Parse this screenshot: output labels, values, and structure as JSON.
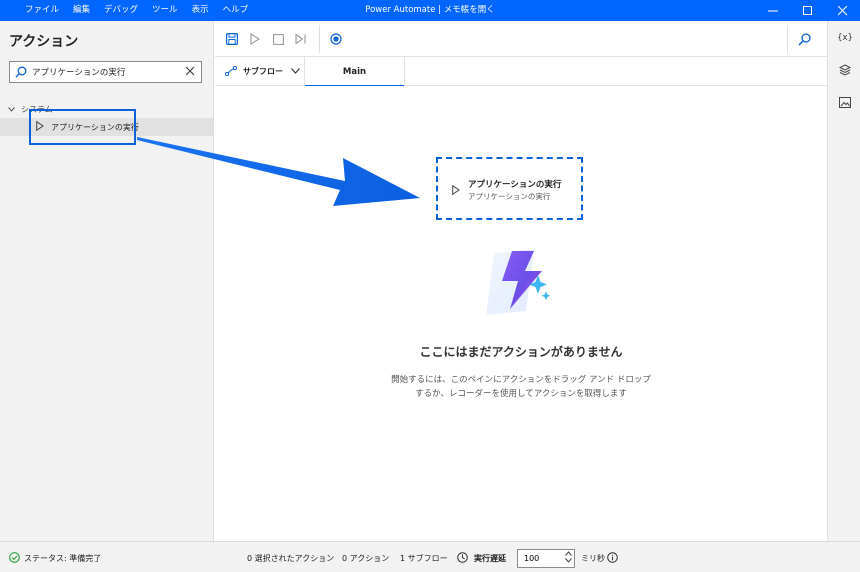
{
  "titlebar": {
    "menu": [
      "ファイル",
      "編集",
      "デバッグ",
      "ツール",
      "表示",
      "ヘルプ"
    ],
    "title": "Power Automate | メモ帳を開く"
  },
  "actions_panel": {
    "title": "アクション",
    "search": {
      "value": "アプリケーションの実行",
      "placeholder": "アクションの検索"
    },
    "category": "システム",
    "item": "アプリケーションの実行"
  },
  "tabs": {
    "subflow_label": "サブフロー",
    "main_tab": "Main"
  },
  "drag_card": {
    "title": "アプリケーションの実行",
    "subtitle": "アプリケーションの実行"
  },
  "empty_state": {
    "title": "ここにはまだアクションがありません",
    "desc_line1": "開始するには、このペインにアクションをドラッグ アンド ドロップ",
    "desc_line2": "するか、レコーダーを使用してアクションを取得します"
  },
  "right_bar": {
    "variables_label": "{x}"
  },
  "status": {
    "state": "ステータス: 準備完了",
    "selected_actions": "0 選択されたアクション",
    "actions": "0 アクション",
    "subflows": "1 サブフロー",
    "run_delay_label": "実行遅延",
    "run_delay_value": "100",
    "unit": "ミリ秒"
  },
  "colors": {
    "titlebar": "#0066ff",
    "accent": "#0a63d6",
    "status_ok": "#2e9e3e"
  },
  "icons": [
    "save-icon",
    "run-icon",
    "stop-icon",
    "step-icon",
    "record-icon",
    "search-icon",
    "variables-icon",
    "layers-icon",
    "images-icon",
    "clock-icon",
    "info-icon",
    "lightning-icon"
  ]
}
